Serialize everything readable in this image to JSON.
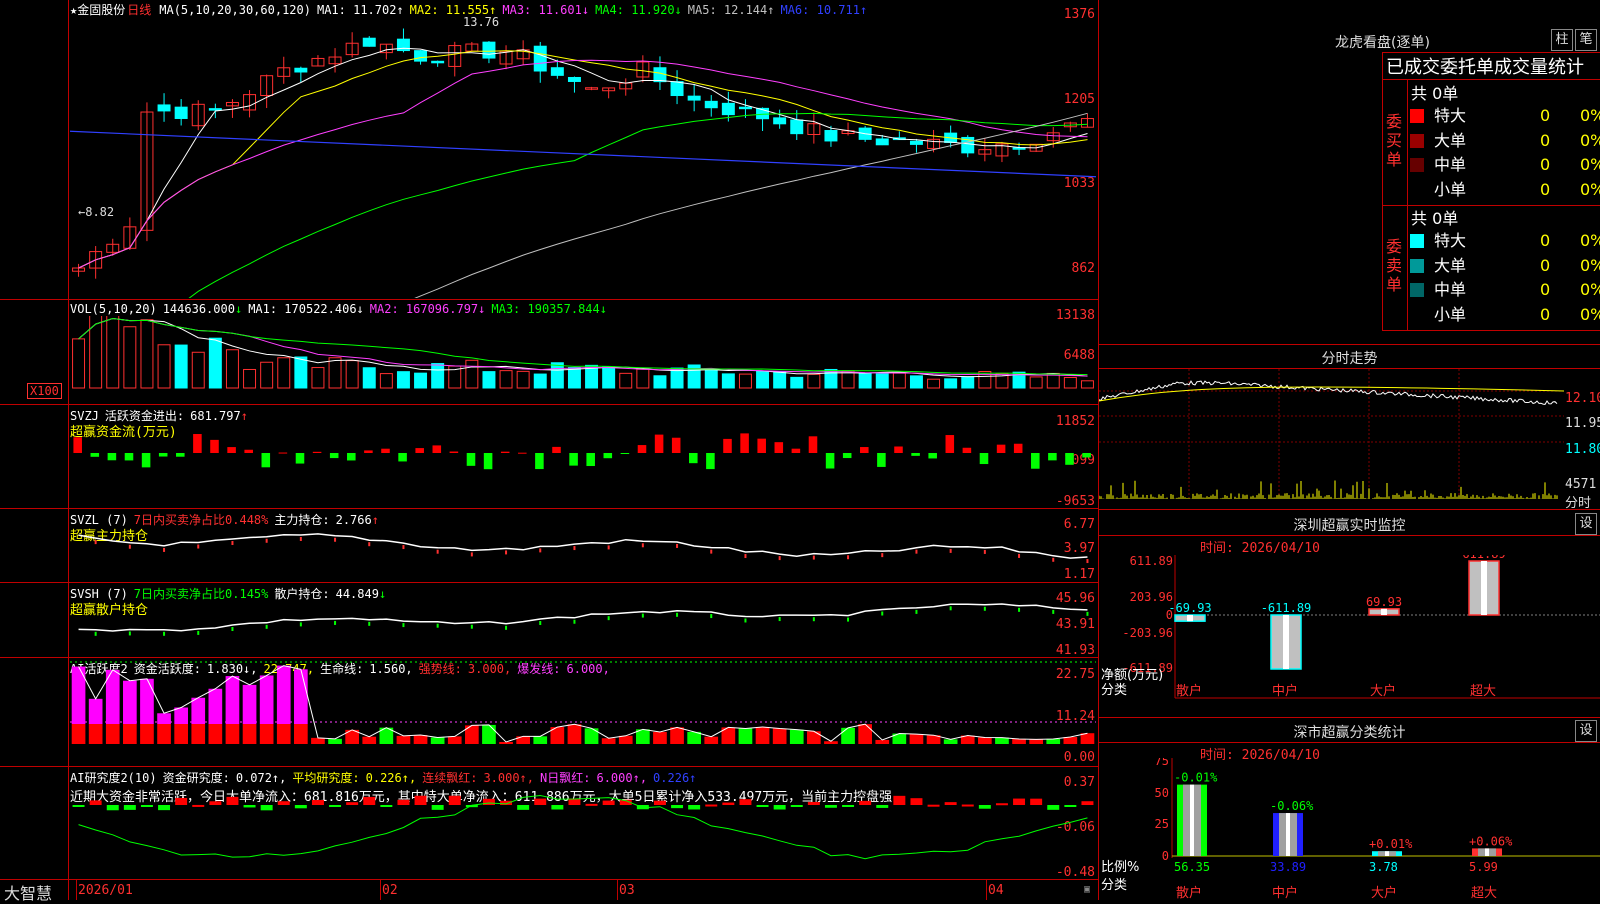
{
  "main": {
    "title_star": "★金固股份",
    "period": "日线",
    "ma_label": "MA(5,10,20,30,60,120)",
    "mas": [
      {
        "name": "MA1:",
        "value": "11.702",
        "arrow": "↑",
        "color": "#ffffff"
      },
      {
        "name": "MA2:",
        "value": "11.555",
        "arrow": "↑",
        "color": "#ffff00"
      },
      {
        "name": "MA3:",
        "value": "11.601",
        "arrow": "↓",
        "color": "#ff40ff"
      },
      {
        "name": "MA4:",
        "value": "11.920",
        "arrow": "↓",
        "color": "#00ff00"
      },
      {
        "name": "MA5:",
        "value": "12.144",
        "arrow": "↑",
        "color": "#c0c0c0"
      },
      {
        "name": "MA6:",
        "value": "10.711",
        "arrow": "↑",
        "color": "#3040ff"
      }
    ],
    "y_ticks": [
      "1376",
      "1205",
      "1033",
      "862"
    ],
    "high_label": "13.76",
    "low_label": "←8.82",
    "up_color": "#ff3030",
    "down_color": "#00ffff"
  },
  "vol": {
    "label": "VOL(5,10,20)",
    "value": "144636.000",
    "arrow": "↓",
    "mas": [
      {
        "name": "MA1:",
        "value": "170522.406",
        "arrow": "↓",
        "color": "#ffffff"
      },
      {
        "name": "MA2:",
        "value": "167096.797",
        "arrow": "↓",
        "color": "#ff40ff"
      },
      {
        "name": "MA3:",
        "value": "190357.844",
        "arrow": "↓",
        "color": "#00ff00"
      }
    ],
    "y_ticks": [
      "13138",
      "6488"
    ],
    "unit": "X100"
  },
  "svzj": {
    "label": "SVZJ",
    "name": "活跃资金进出:",
    "value": "681.797",
    "arrow": "↑",
    "sub": "超赢资金流(万元)",
    "y_ticks": [
      "11852",
      "1099",
      "-9653"
    ]
  },
  "svzl": {
    "label": "SVZL (7)",
    "ratio_text": "7日内买卖净占比0.448%",
    "hold_name": "主力持仓:",
    "hold_value": "2.766",
    "arrow": "↑",
    "sub": "超赢主力持仓",
    "y_ticks": [
      "6.77",
      "3.97",
      "1.17"
    ]
  },
  "svsh": {
    "label": "SVSH (7)",
    "ratio_text": "7日内买卖净占比0.145%",
    "hold_name": "散户持仓:",
    "hold_value": "44.849",
    "arrow": "↓",
    "sub": "超赢散户持仓",
    "y_ticks": [
      "45.96",
      "43.91",
      "41.93"
    ]
  },
  "ai1": {
    "label": "AI活跃度2",
    "items": [
      {
        "text": "资金活跃度:",
        "color": "#ffffff"
      },
      {
        "text": "1.830↓,",
        "color": "#ffffff"
      },
      {
        "text": "22.747,",
        "color": "#ffff00"
      },
      {
        "text": "生命线:",
        "color": "#ffffff"
      },
      {
        "text": "1.560,",
        "color": "#ffffff"
      },
      {
        "text": "强势线:",
        "color": "#ff3030"
      },
      {
        "text": "3.000,",
        "color": "#ff3030"
      },
      {
        "text": "爆发线:",
        "color": "#ff40ff"
      },
      {
        "text": "6.000,",
        "color": "#ff40ff"
      }
    ],
    "y_ticks": [
      "22.75",
      "11.24",
      "0.00"
    ]
  },
  "ai2": {
    "label": "AI研究度2(10)",
    "items": [
      {
        "text": "资金研究度:",
        "color": "#ffffff"
      },
      {
        "text": "0.072↑,",
        "color": "#ffffff"
      },
      {
        "text": "平均研究度:",
        "color": "#ffff00"
      },
      {
        "text": "0.226↑,",
        "color": "#ffff00"
      },
      {
        "text": "连续飘红:",
        "color": "#ff3030"
      },
      {
        "text": "3.000↑,",
        "color": "#ff3030"
      },
      {
        "text": "N日飘红:",
        "color": "#ff40ff"
      },
      {
        "text": "6.000↑,",
        "color": "#ff40ff"
      },
      {
        "text": "0.226↑",
        "color": "#3040ff"
      }
    ],
    "comment": "近期大资金非常活跃，今日大单净流入：681.816万元，其中特大单净流入：611.886万元，大单5日累计净入533.497万元，当前主力控盘强",
    "y_ticks": [
      "0.37",
      "-0.06",
      "-0.48"
    ]
  },
  "bottom": {
    "brand": "大智慧",
    "dates": [
      "2026/01",
      "02",
      "03",
      "04"
    ]
  },
  "lhb": {
    "title": "龙虎看盘(逐单)",
    "btn1": "柱",
    "btn2": "笔",
    "subtitle": "已成交委托单成交量统计",
    "buy": {
      "label": "委买单",
      "total": "共 0单",
      "rows": [
        {
          "name": "特大",
          "v1": "0",
          "v2": "0%",
          "color": "#ff0000"
        },
        {
          "name": "大单",
          "v1": "0",
          "v2": "0%",
          "color": "#990000"
        },
        {
          "name": "中单",
          "v1": "0",
          "v2": "0%",
          "color": "#660000"
        },
        {
          "name": "小单",
          "v1": "0",
          "v2": "0%",
          "color": "#000000"
        }
      ]
    },
    "sell": {
      "label": "委卖单",
      "total": "共 0单",
      "rows": [
        {
          "name": "特大",
          "v1": "0",
          "v2": "0%",
          "color": "#00ffff"
        },
        {
          "name": "大单",
          "v1": "0",
          "v2": "0%",
          "color": "#009999"
        },
        {
          "name": "中单",
          "v1": "0",
          "v2": "0%",
          "color": "#006666"
        },
        {
          "name": "小单",
          "v1": "0",
          "v2": "0%",
          "color": "#000000"
        }
      ]
    }
  },
  "fenshi": {
    "title": "分时走势",
    "y_ticks": [
      "12.10",
      "11.95",
      "11.80"
    ],
    "vol_label": "4571",
    "vol_unit": "分时"
  },
  "sz_monitor": {
    "title": "深圳超赢实时监控",
    "btn": "设",
    "time": "时间: 2026/04/10",
    "y_ticks": [
      "611.89",
      "203.96",
      "0",
      "-203.96",
      "-611.89"
    ],
    "ylabel": "净额(万元)",
    "xlabel": "分类",
    "categories": [
      "散户",
      "中户",
      "大户",
      "超大"
    ],
    "values": [
      "-69.93",
      "-611.89",
      "69.93",
      "611.89"
    ]
  },
  "sz_class": {
    "title": "深市超赢分类统计",
    "btn": "设",
    "time": "时间: 2026/04/10",
    "y_ticks": [
      "75",
      "50",
      "25",
      "0"
    ],
    "ylabel": "比例%",
    "xlabel": "分类",
    "categories": [
      "散户",
      "中户",
      "大户",
      "超大"
    ],
    "values": [
      "56.35",
      "33.89",
      "3.78",
      "5.99"
    ],
    "changes": [
      "-0.01%",
      "-0.06%",
      "+0.01%",
      "+0.06%"
    ]
  },
  "chart_data": [
    {
      "type": "candlestick",
      "title": "金固股份 日线",
      "x": [
        "2026/01",
        "02",
        "03",
        "04"
      ],
      "ylim": [
        8.62,
        13.76
      ],
      "high": 13.76,
      "low": 8.82
    },
    {
      "type": "bar",
      "title": "深圳超赢实时监控",
      "categories": [
        "散户",
        "中户",
        "大户",
        "超大"
      ],
      "values": [
        -69.93,
        -611.89,
        69.93,
        611.89
      ],
      "ylabel": "净额(万元)",
      "ylim": [
        -611.89,
        611.89
      ]
    },
    {
      "type": "bar",
      "title": "深市超赢分类统计",
      "categories": [
        "散户",
        "中户",
        "大户",
        "超大"
      ],
      "values": [
        56.35,
        33.89,
        3.78,
        5.99
      ],
      "ylabel": "比例%",
      "ylim": [
        0,
        75
      ]
    }
  ]
}
